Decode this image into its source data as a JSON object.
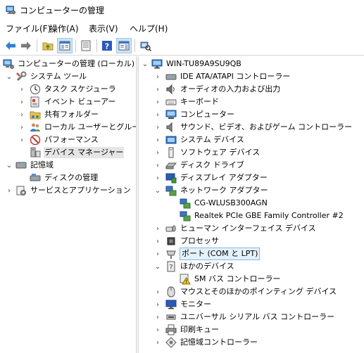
{
  "window": {
    "title": "コンピューターの管理"
  },
  "menu": [
    {
      "label": "ファイル(F)"
    },
    {
      "label": "操作(A)"
    },
    {
      "label": "表示(V)"
    },
    {
      "label": "ヘルプ(H)"
    }
  ],
  "toolbar": {
    "buttons": [
      "back-icon",
      "forward-icon",
      "up-folder-icon",
      "show-hide-tree-icon",
      "properties-icon",
      "help-icon",
      "action-pane-icon",
      "scan-hardware-icon"
    ]
  },
  "left_tree": {
    "root": "コンピューターの管理 (ローカル)",
    "system_tools": "システム ツール",
    "task_scheduler": "タスク スケジューラ",
    "event_viewer": "イベント ビューアー",
    "shared_folders": "共有フォルダー",
    "local_users": "ローカル ユーザーとグループ",
    "performance": "パフォーマンス",
    "device_manager": "デバイス マネージャー",
    "storage": "記憶域",
    "disk_management": "ディスクの管理",
    "services_apps": "サービスとアプリケーション"
  },
  "right_tree": {
    "computer": "WIN-TU89A9SU9QB",
    "items": [
      {
        "label": "IDE ATA/ATAPI コントローラー"
      },
      {
        "label": "オーディオの入力および出力"
      },
      {
        "label": "キーボード"
      },
      {
        "label": "コンピューター"
      },
      {
        "label": "サウンド、ビデオ、およびゲーム コントローラー"
      },
      {
        "label": "システム デバイス"
      },
      {
        "label": "ソフトウェア デバイス"
      },
      {
        "label": "ディスク ドライブ"
      },
      {
        "label": "ディスプレイ アダプター"
      },
      {
        "label": "ネットワーク アダプター"
      },
      {
        "label": "CG-WLUSB300AGN"
      },
      {
        "label": "Realtek PCIe GBE Family Controller #2"
      },
      {
        "label": "ヒューマン インターフェイス デバイス"
      },
      {
        "label": "プロセッサ"
      },
      {
        "label": "ポート (COM と LPT)"
      },
      {
        "label": "ほかのデバイス"
      },
      {
        "label": "SM バス コントローラー"
      },
      {
        "label": "マウスとそのほかのポインティング デバイス"
      },
      {
        "label": "モニター"
      },
      {
        "label": "ユニバーサル シリアル バス コントローラー"
      },
      {
        "label": "印刷キュー"
      },
      {
        "label": "記憶域コントローラー"
      }
    ]
  }
}
